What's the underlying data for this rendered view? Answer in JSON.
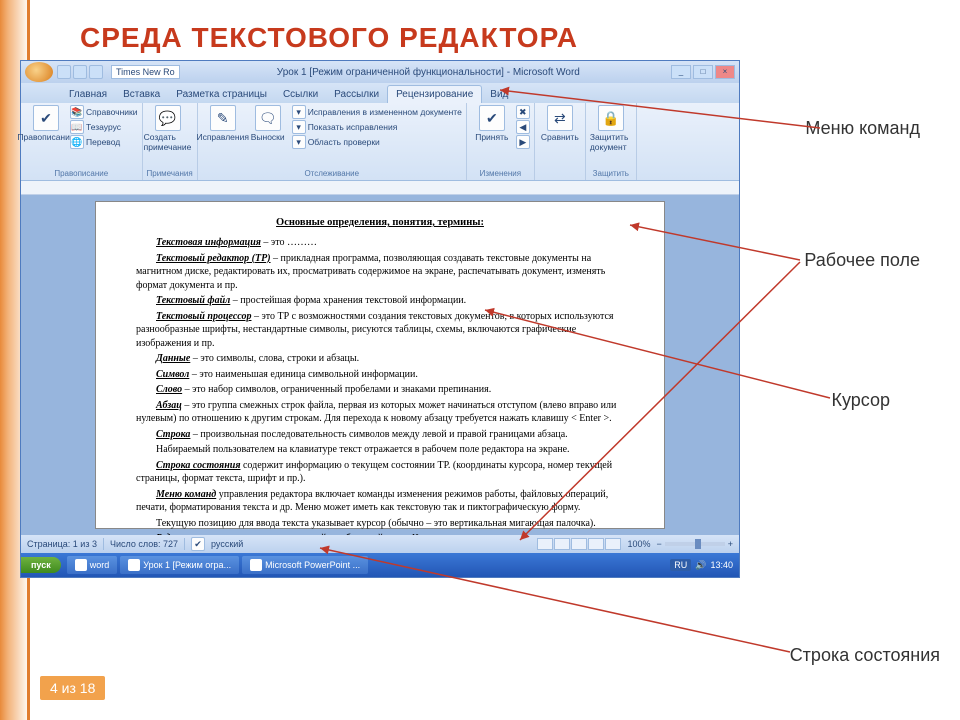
{
  "slide": {
    "title": "СРЕДА ТЕКСТОВОГО РЕДАКТОРА",
    "page_label": "4 из 18"
  },
  "callouts": {
    "menu": "Меню команд",
    "workarea": "Рабочее поле",
    "cursor": "Курсор",
    "statusbar": "Строка состояния"
  },
  "titlebar": {
    "font": "Times New Ro",
    "title": "Урок 1 [Режим ограниченной функциональности] - Microsoft Word"
  },
  "tabs": {
    "home": "Главная",
    "insert": "Вставка",
    "layout": "Разметка страницы",
    "refs": "Ссылки",
    "mail": "Рассылки",
    "review": "Рецензирование",
    "view": "Вид"
  },
  "ribbon": {
    "spell_group": "Правописание",
    "spell_btn": "Правописание",
    "ref": "Справочники",
    "thes": "Тезаурус",
    "trans": "Перевод",
    "lang_group": "",
    "comment_btn": "Создать примечание",
    "comment_group": "Примечания",
    "track_btn": "Исправления",
    "balloons_btn": "Выноски",
    "track_opt1": "Исправления в измененном документе",
    "track_opt2": "Показать исправления",
    "track_opt3": "Область проверки",
    "track_group": "Отслеживание",
    "accept_btn": "Принять",
    "changes_group": "Изменения",
    "compare_btn": "Сравнить",
    "protect_btn": "Защитить документ",
    "protect_group": "Защитить"
  },
  "doc": {
    "heading": "Основные определения, понятия, термины:",
    "p1_term": "Текстовая информация",
    "p1_rest": " – это ………",
    "p2_term": "Текстовый редактор (ТР)",
    "p2_rest": " – прикладная программа, позволяющая создавать текстовые документы на магнитном диске, редактировать их, просматривать содержимое на экране, распечатывать документ, изменять формат документа и пр.",
    "p3_term": "Текстовый файл",
    "p3_rest": " – простейшая форма хранения текстовой информации.",
    "p4_term": "Текстовый процессор",
    "p4_rest": " – это ТР с возможностями создания текстовых документов, в которых используются разнообразные шрифты, нестандартные символы, рисуются таблицы, схемы, включаются графические изображения и пр.",
    "p5_term": "Данные",
    "p5_rest": " – это символы, слова, строки и абзацы.",
    "p6_term": "Символ",
    "p6_rest": " – это наименьшая единица символьной информации.",
    "p7_term": "Слово",
    "p7_rest": " – это набор символов, ограниченный пробелами и знаками препинания.",
    "p8_term": "Абзац",
    "p8_rest": " – это группа смежных строк файла, первая из которых может начинаться отступом (влево вправо или нулевым) по отношению к другим строкам. Для перехода к новому абзацу требуется нажать клавишу < Enter >.",
    "p9_term": "Строка",
    "p9_rest": " – произвольная последовательность символов между левой и правой границами абзаца.",
    "p10": "Набираемый пользователем на клавиатуре текст отражается в рабочем поле редактора на экране.",
    "p11_term": "Строка состояния",
    "p11_rest": " содержит информацию о текущем состоянии ТР. (координаты курсора, номер текущей страницы, формат текста, шрифт и пр.).",
    "p12_term": "Меню команд",
    "p12_rest": " управления редактора включает команды изменения режимов работы, файловых операций, печати, форматирования текста и др. Меню может иметь как текстовую так и пиктографическую форму.",
    "p13": "Текущую позицию для ввода текста указывает курсор (обычно – это вертикальная мигающая палочка).",
    "p14_term": "Редактирование",
    "p14_rest": " – внесение изменений в набранный текст. Чаще всего приходится"
  },
  "status": {
    "page": "Страница: 1 из 3",
    "words": "Число слов: 727",
    "lang": "русский",
    "zoom": "100%"
  },
  "taskbar": {
    "start": "пуск",
    "item1": "word",
    "item2": "Урок 1 [Режим огра...",
    "item3": "Microsoft PowerPoint ...",
    "lang": "RU",
    "time": "13:40"
  }
}
